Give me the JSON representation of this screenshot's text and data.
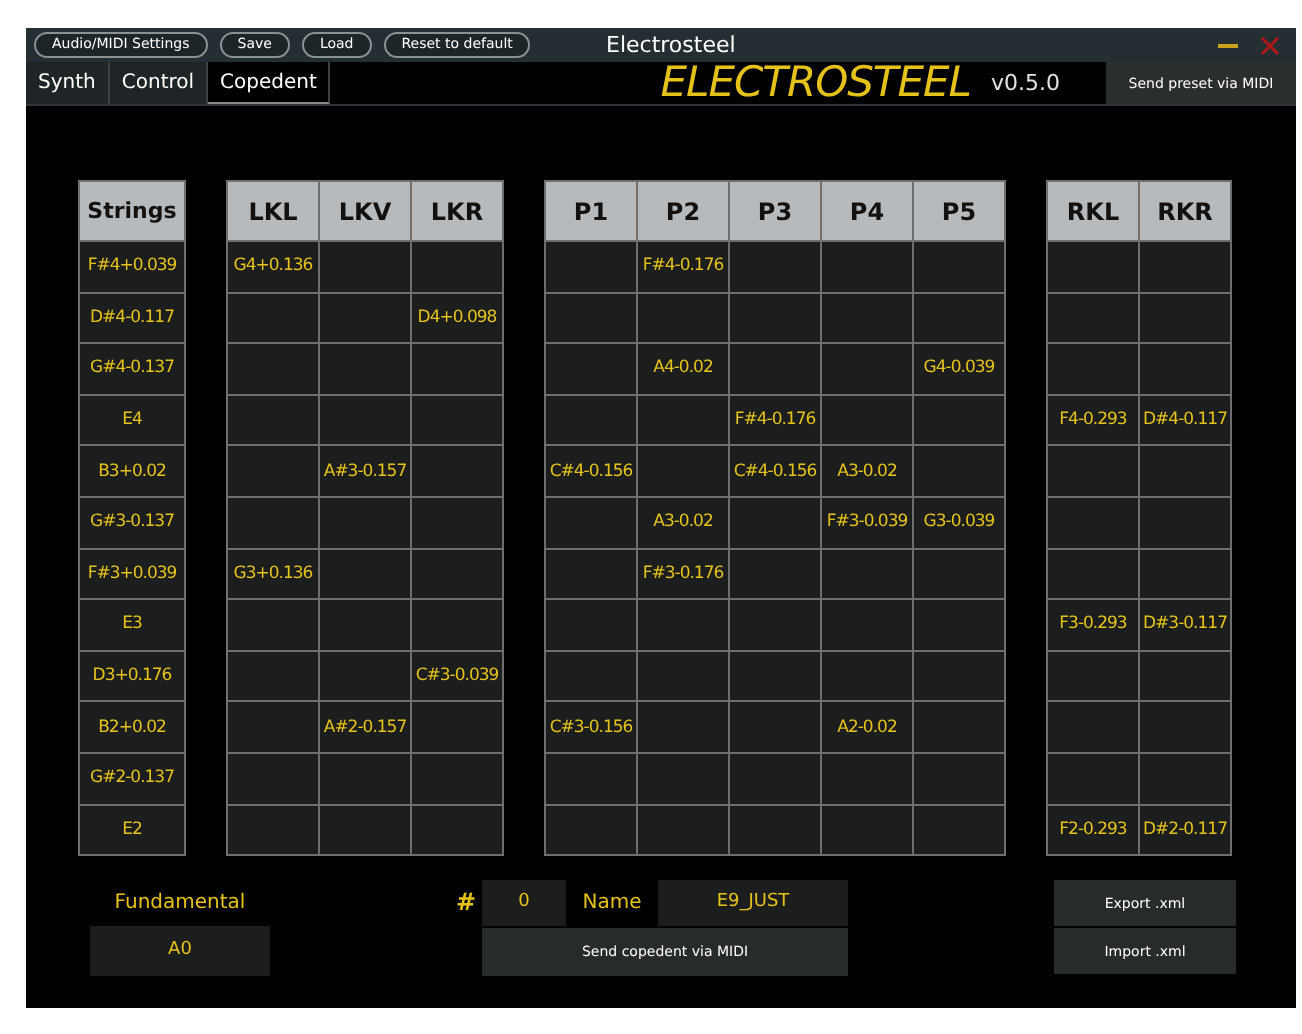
{
  "window": {
    "title": "Electrosteel",
    "buttons": [
      "Audio/MIDI Settings",
      "Save",
      "Load",
      "Reset to default"
    ]
  },
  "tabs": [
    {
      "label": "Synth",
      "selected": false
    },
    {
      "label": "Control",
      "selected": false
    },
    {
      "label": "Copedent",
      "selected": true
    }
  ],
  "header": {
    "logo": "ELECTROSTEEL",
    "version": "v0.5.0",
    "send_preset": "Send preset via MIDI"
  },
  "strings": {
    "header": "Strings",
    "cells": [
      "F#4+0.039",
      "D#4-0.117",
      "G#4-0.137",
      "E4",
      "B3+0.02",
      "G#3-0.137",
      "F#3+0.039",
      "E3",
      "D3+0.176",
      "B2+0.02",
      "G#2-0.137",
      "E2"
    ]
  },
  "groups": [
    {
      "columns": [
        {
          "header": "LKL",
          "cells": [
            "G4+0.136",
            null,
            null,
            null,
            null,
            null,
            "G3+0.136",
            null,
            null,
            null,
            null,
            null
          ]
        },
        {
          "header": "LKV",
          "cells": [
            null,
            null,
            null,
            null,
            "A#3-0.157",
            null,
            null,
            null,
            null,
            "A#2-0.157",
            null,
            null
          ]
        },
        {
          "header": "LKR",
          "cells": [
            null,
            "D4+0.098",
            null,
            null,
            null,
            null,
            null,
            null,
            "C#3-0.039",
            null,
            null,
            null
          ]
        }
      ]
    },
    {
      "columns": [
        {
          "header": "P1",
          "cells": [
            null,
            null,
            null,
            null,
            "C#4-0.156",
            null,
            null,
            null,
            null,
            "C#3-0.156",
            null,
            null
          ]
        },
        {
          "header": "P2",
          "cells": [
            "F#4-0.176",
            null,
            "A4-0.02",
            null,
            null,
            "A3-0.02",
            "F#3-0.176",
            null,
            null,
            null,
            null,
            null
          ]
        },
        {
          "header": "P3",
          "cells": [
            null,
            null,
            null,
            "F#4-0.176",
            "C#4-0.156",
            null,
            null,
            null,
            null,
            null,
            null,
            null
          ]
        },
        {
          "header": "P4",
          "cells": [
            null,
            null,
            null,
            null,
            "A3-0.02",
            "F#3-0.039",
            null,
            null,
            null,
            "A2-0.02",
            null,
            null
          ]
        },
        {
          "header": "P5",
          "cells": [
            null,
            null,
            "G4-0.039",
            null,
            null,
            "G3-0.039",
            null,
            null,
            null,
            null,
            null,
            null
          ]
        }
      ]
    },
    {
      "columns": [
        {
          "header": "RKL",
          "cells": [
            null,
            null,
            null,
            "F4-0.293",
            null,
            null,
            null,
            "F3-0.293",
            null,
            null,
            null,
            "F2-0.293"
          ]
        },
        {
          "header": "RKR",
          "cells": [
            null,
            null,
            null,
            "D#4-0.117",
            null,
            null,
            null,
            "D#3-0.117",
            null,
            null,
            null,
            "D#2-0.117"
          ]
        }
      ]
    }
  ],
  "fundamental": {
    "label": "Fundamental",
    "value": "A0"
  },
  "copedent": {
    "number_label": "#",
    "number": "0",
    "name_label": "Name",
    "name": "E9_JUST",
    "send": "Send copedent via MIDI"
  },
  "file_buttons": [
    "Export .xml",
    "Import .xml"
  ]
}
